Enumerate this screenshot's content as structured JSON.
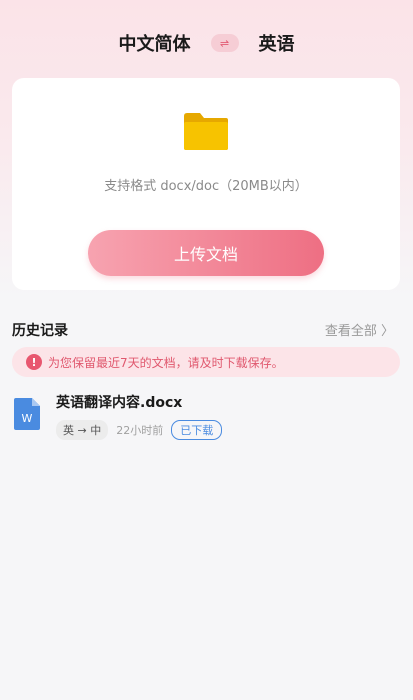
{
  "header": {
    "source_lang": "中文简体",
    "swap_icon": "⇌",
    "target_lang": "英语"
  },
  "upload": {
    "formats_text": "支持格式 docx/doc（20MB以内）",
    "button_label": "上传文档"
  },
  "history": {
    "title": "历史记录",
    "view_all": "查看全部 〉",
    "notice_icon": "!",
    "notice": "为您保留最近7天的文档，请及时下载保存。",
    "items": [
      {
        "name": "英语翻译内容.docx",
        "lang_pair": "英 → 中",
        "time": "22小时前",
        "status": "已下载"
      }
    ]
  },
  "colors": {
    "accent": "#ee6f83",
    "folder": "#f7c300",
    "doc_blue": "#4a8be0"
  }
}
